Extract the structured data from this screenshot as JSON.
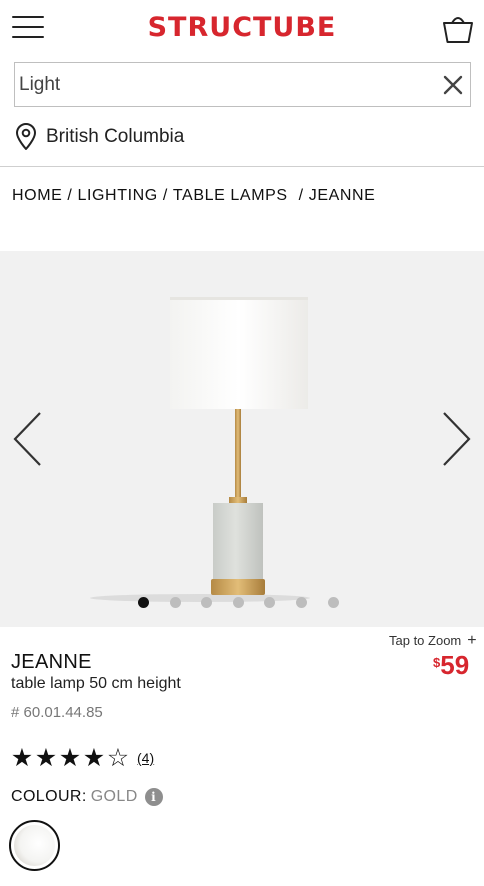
{
  "header": {
    "logo": "STRUCTUBE",
    "menu_icon": "hamburger-menu-icon",
    "cart_icon": "shopping-basket-icon",
    "brand_color": "#d7262e"
  },
  "search": {
    "value": "Light",
    "clear_icon": "close-icon"
  },
  "location": {
    "icon": "location-pin-icon",
    "label": "British Columbia"
  },
  "breadcrumb": {
    "items": [
      "HOME",
      "LIGHTING",
      "TABLE LAMPS",
      "JEANNE"
    ],
    "separator": "/"
  },
  "gallery": {
    "image_count": 7,
    "active_index": 0,
    "prev_icon": "chevron-left-icon",
    "next_icon": "chevron-right-icon",
    "zoom_label": "Tap to Zoom",
    "zoom_symbol": "+"
  },
  "product": {
    "name": "JEANNE",
    "description": "table lamp 50 cm height",
    "sku": "# 60.01.44.85",
    "price_currency": "$",
    "price_amount": "59",
    "price_color": "#d7262e"
  },
  "rating": {
    "stars_filled": 4,
    "stars_total": 5,
    "filled_star": "★",
    "empty_star": "☆",
    "review_count": "(4)"
  },
  "colour": {
    "label": "COLOUR:",
    "value": "GOLD",
    "info_symbol": "i",
    "info_icon": "info-icon"
  }
}
